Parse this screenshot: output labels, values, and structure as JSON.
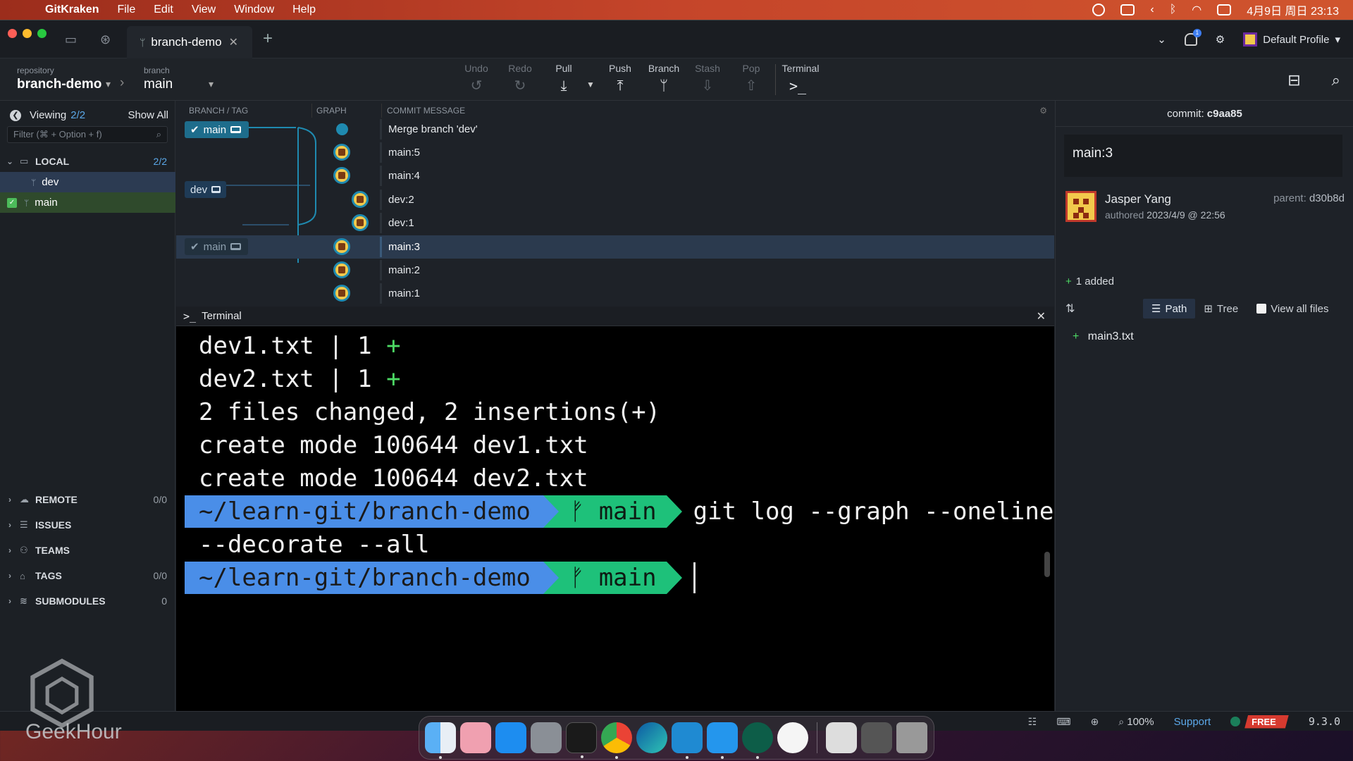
{
  "menubar": {
    "app_name": "GitKraken",
    "items": [
      "File",
      "Edit",
      "View",
      "Window",
      "Help"
    ],
    "datetime": "4月9日 周日  23:13"
  },
  "titlebar": {
    "tab_title": "branch-demo",
    "profile": "Default Profile",
    "notification_count": "1"
  },
  "toolbar": {
    "repository_label": "repository",
    "repository_value": "branch-demo",
    "branch_label": "branch",
    "branch_value": "main",
    "buttons": {
      "undo": "Undo",
      "redo": "Redo",
      "pull": "Pull",
      "push": "Push",
      "branch": "Branch",
      "stash": "Stash",
      "pop": "Pop",
      "terminal": "Terminal"
    }
  },
  "sidebar": {
    "viewing_label": "Viewing",
    "viewing_count": "2/2",
    "show_all": "Show All",
    "filter_placeholder": "Filter (⌘ + Option + f)",
    "local": {
      "label": "LOCAL",
      "count": "2/2"
    },
    "branches": [
      "dev",
      "main"
    ],
    "remote": {
      "label": "REMOTE",
      "count": "0/0"
    },
    "issues": {
      "label": "ISSUES"
    },
    "teams": {
      "label": "TEAMS"
    },
    "tags": {
      "label": "TAGS",
      "count": "0/0"
    },
    "submodules": {
      "label": "SUBMODULES",
      "count": "0"
    }
  },
  "watermark": "GeekHour",
  "graph": {
    "headers": {
      "branch_tag": "BRANCH / TAG",
      "graph": "GRAPH",
      "commit_message": "COMMIT MESSAGE"
    },
    "labels": {
      "main": "main",
      "dev": "dev",
      "main_old": "main"
    },
    "commits": [
      "Merge branch 'dev'",
      "main:5",
      "main:4",
      "dev:2",
      "dev:1",
      "main:3",
      "main:2",
      "main:1"
    ]
  },
  "terminal": {
    "title": "Terminal",
    "lines": {
      "l1_text": "dev1.txt | 1 ",
      "l1_plus": "+",
      "l2_text": "dev2.txt | 1 ",
      "l2_plus": "+",
      "l3": "2 files changed, 2 insertions(+)",
      "l4": "create mode 100644 dev1.txt",
      "l5": "create mode 100644 dev2.txt",
      "cont": "--decorate --all"
    },
    "prompt_path": "~/learn-git/branch-demo",
    "prompt_branch": "main",
    "prompt_branch_glyph": "ᚠ",
    "command": "git log --graph --oneline"
  },
  "details": {
    "commit_label": "commit:",
    "commit_hash": "c9aa85",
    "message": "main:3",
    "author": "Jasper Yang",
    "authored_label": "authored",
    "authored_date": "2023/4/9 @ 22:56",
    "parent_label": "parent:",
    "parent_hash": "d30b8d",
    "added_summary": "1 added",
    "path_label": "Path",
    "tree_label": "Tree",
    "view_all_files": "View all files",
    "files": [
      "main3.txt"
    ]
  },
  "statusbar": {
    "zoom": "100%",
    "support": "Support",
    "plan": "FREE",
    "version": "9.3.0"
  },
  "colors": {
    "accent_blue": "#4a8ee8",
    "accent_green": "#1ec17a",
    "selected_row": "#2b3a4e",
    "free_badge": "#d63a2f"
  }
}
